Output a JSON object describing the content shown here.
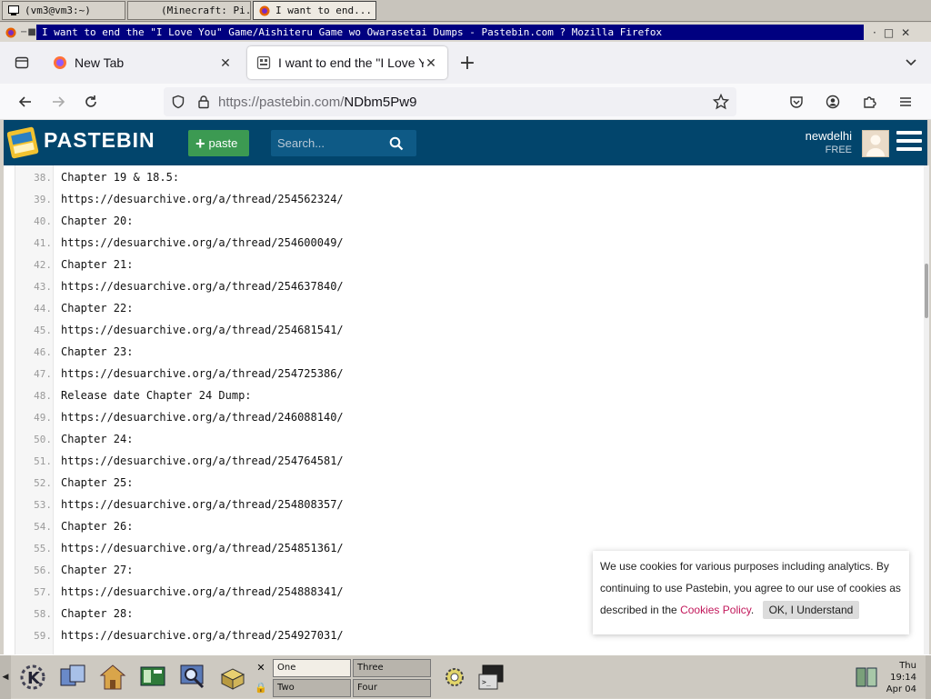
{
  "wm_taskbar": {
    "tasks": [
      {
        "label": "(vm3@vm3:~)"
      },
      {
        "label": "(Minecraft: Pi..."
      },
      {
        "label": "I want to end..."
      }
    ]
  },
  "window": {
    "title": "I want to end the \"I Love You\" Game/Aishiteru Game wo Owarasetai Dumps - Pastebin.com ? Mozilla Firefox"
  },
  "browser": {
    "tabs": [
      {
        "label": "New Tab"
      },
      {
        "label": "I want to end the \"I Love You\" Game"
      }
    ],
    "url_host": "https://pastebin.com/",
    "url_path": "NDbm5Pw9"
  },
  "pastebin": {
    "logo_text": "PASTEBIN",
    "paste_label": "paste",
    "search_placeholder": "Search...",
    "username": "newdelhi",
    "tier": "FREE",
    "brand_color": "#02456c",
    "accent_color": "#3c9a52"
  },
  "code": {
    "lines": [
      {
        "num": "38.",
        "text": "Chapter 19 & 18.5:"
      },
      {
        "num": "39.",
        "text": "https://desuarchive.org/a/thread/254562324/"
      },
      {
        "num": "40.",
        "text": "Chapter 20:"
      },
      {
        "num": "41.",
        "text": "https://desuarchive.org/a/thread/254600049/"
      },
      {
        "num": "42.",
        "text": "Chapter 21:"
      },
      {
        "num": "43.",
        "text": "https://desuarchive.org/a/thread/254637840/"
      },
      {
        "num": "44.",
        "text": "Chapter 22:"
      },
      {
        "num": "45.",
        "text": "https://desuarchive.org/a/thread/254681541/"
      },
      {
        "num": "46.",
        "text": "Chapter 23:"
      },
      {
        "num": "47.",
        "text": "https://desuarchive.org/a/thread/254725386/"
      },
      {
        "num": "48.",
        "text": "Release date Chapter 24 Dump:"
      },
      {
        "num": "49.",
        "text": "https://desuarchive.org/a/thread/246088140/"
      },
      {
        "num": "50.",
        "text": "Chapter 24:"
      },
      {
        "num": "51.",
        "text": "https://desuarchive.org/a/thread/254764581/"
      },
      {
        "num": "52.",
        "text": "Chapter 25:"
      },
      {
        "num": "53.",
        "text": "https://desuarchive.org/a/thread/254808357/"
      },
      {
        "num": "54.",
        "text": "Chapter 26:"
      },
      {
        "num": "55.",
        "text": "https://desuarchive.org/a/thread/254851361/"
      },
      {
        "num": "56.",
        "text": "Chapter 27:"
      },
      {
        "num": "57.",
        "text": "https://desuarchive.org/a/thread/254888341/"
      },
      {
        "num": "58.",
        "text": "Chapter 28:"
      },
      {
        "num": "59.",
        "text": "https://desuarchive.org/a/thread/254927031/"
      }
    ]
  },
  "cookie": {
    "text": "We use cookies for various purposes including analytics. By continuing to use Pastebin, you agree to our use of cookies as described in the",
    "link": "Cookies Policy",
    "suffix": ".",
    "button": "OK, I Understand"
  },
  "panel": {
    "desktops": [
      "One",
      "Two",
      "Three",
      "Four"
    ],
    "clock_day": "Thu",
    "clock_time": "19:14",
    "clock_date": "Apr 04"
  }
}
